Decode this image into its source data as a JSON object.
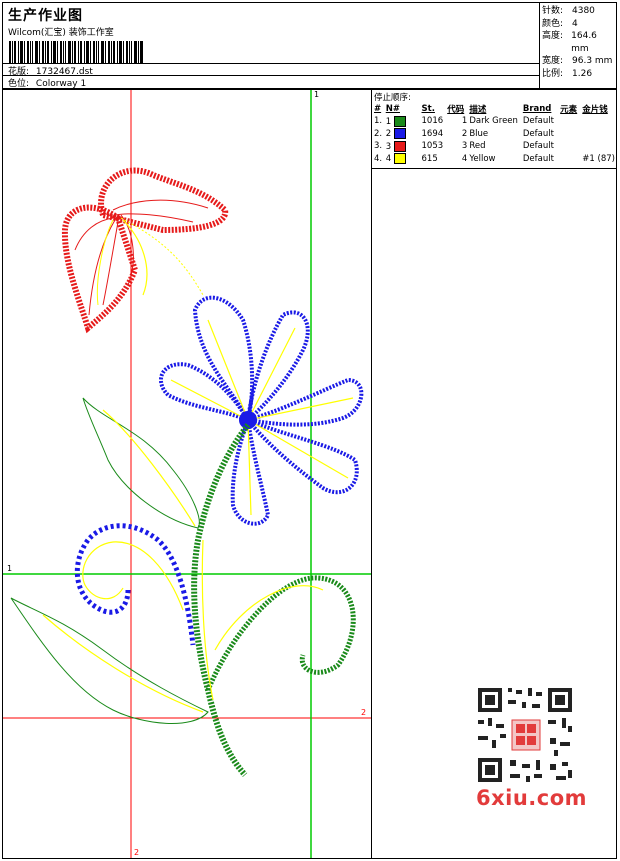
{
  "header": {
    "title": "生产作业图",
    "studio": "Wilcom(汇宝) 装饰工作室",
    "design_label": "花版:",
    "design_value": "1732467.dst",
    "colorway_label": "色位:",
    "colorway_value": "Colorway 1"
  },
  "stats": [
    {
      "label": "针数:",
      "value": "4380"
    },
    {
      "label": "颜色:",
      "value": "4"
    },
    {
      "label": "高度:",
      "value": "164.6 mm"
    },
    {
      "label": "宽度:",
      "value": "96.3 mm"
    },
    {
      "label": "比例:",
      "value": "1.26"
    }
  ],
  "legend": {
    "title": "停止顺序:",
    "columns": [
      "#",
      "N#",
      "St.",
      "代码",
      "描述",
      "Brand",
      "元素",
      "金片钱"
    ],
    "rows": [
      {
        "num": "1.",
        "n": "1",
        "color": "#1a8a1a",
        "st": "1016",
        "code": "1",
        "desc": "Dark Green",
        "brand": "Default",
        "elem": "",
        "seq": ""
      },
      {
        "num": "2.",
        "n": "2",
        "color": "#1a1ae6",
        "st": "1694",
        "code": "2",
        "desc": "Blue",
        "brand": "Default",
        "elem": "",
        "seq": ""
      },
      {
        "num": "3.",
        "n": "3",
        "color": "#e61a1a",
        "st": "1053",
        "code": "3",
        "desc": "Red",
        "brand": "Default",
        "elem": "",
        "seq": ""
      },
      {
        "num": "4.",
        "n": "4",
        "color": "#ffff00",
        "st": "615",
        "code": "4",
        "desc": "Yellow",
        "brand": "Default",
        "elem": "",
        "seq": "#1 (87)"
      }
    ]
  },
  "guides": {
    "top_green": "1",
    "left_green": "1",
    "right_red": "2",
    "bottom_red": "2"
  },
  "colors": {
    "thread_green": "#1a8a1a",
    "thread_blue": "#1a1ae6",
    "thread_red": "#e61a1a",
    "thread_yellow": "#ffff00",
    "guide_red": "#ff0000",
    "guide_green": "#00cc00",
    "watermark": "#e23b3b"
  },
  "watermark": {
    "text": "6xiu.com"
  }
}
